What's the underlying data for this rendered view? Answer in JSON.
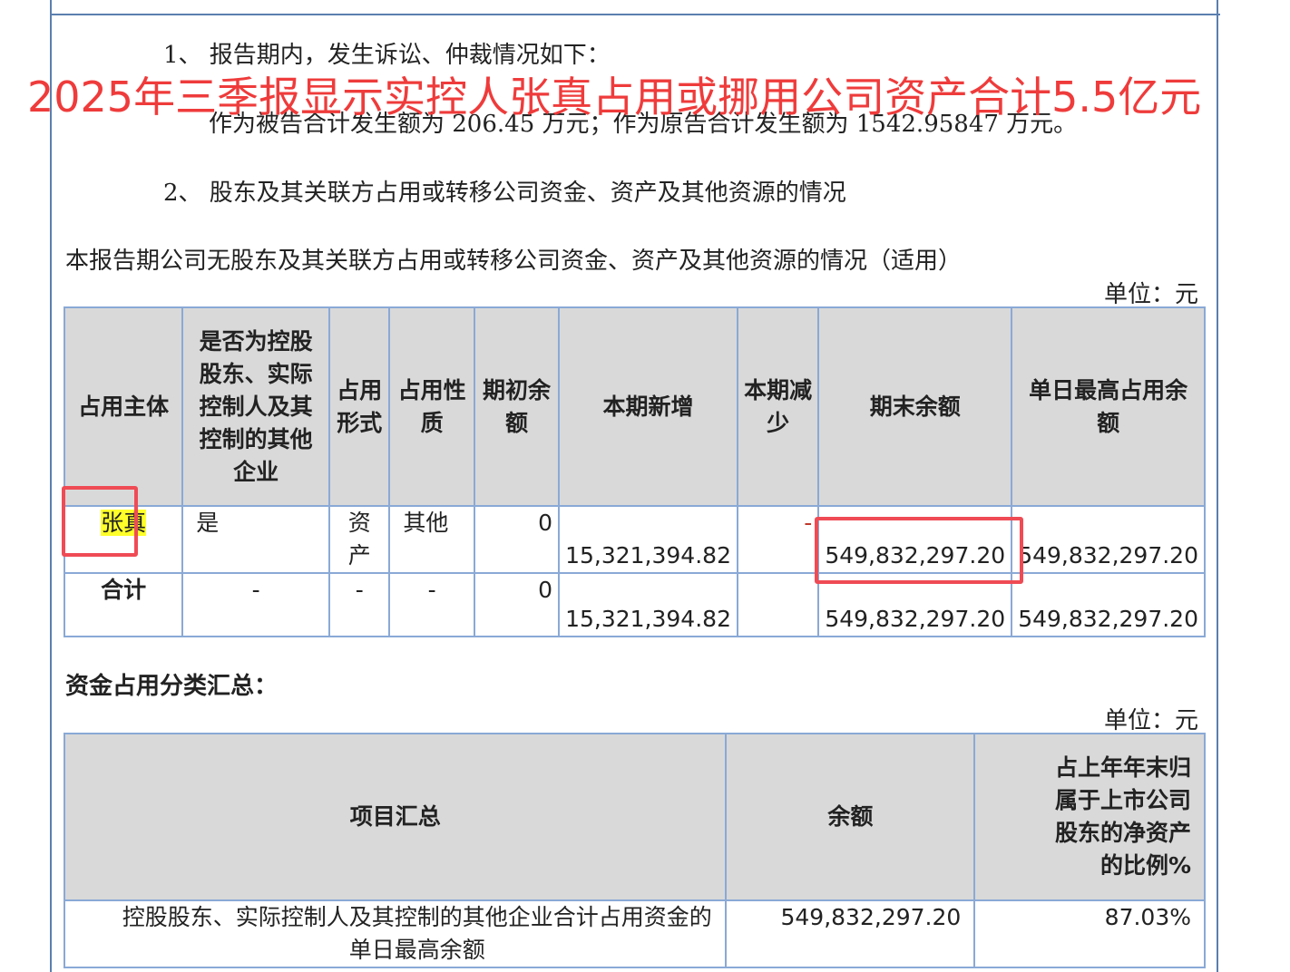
{
  "paragraphs": {
    "p1": "1、 报告期内，发生诉讼、仲裁情况如下：",
    "p2": "作为被告合计发生额为 206.45 万元；作为原告合计发生额为 1542.95847 万元。",
    "p3": "2、 股东及其关联方占用或转移公司资金、资产及其他资源的情况",
    "p4": "本报告期公司无股东及其关联方占用或转移公司资金、资产及其他资源的情况（适用）"
  },
  "overlay_title": "2025年三季报显示实控人张真占用或挪用公司资产合计5.5亿元",
  "unit_label": "单位：元",
  "table1": {
    "headers": [
      "占用主体",
      "是否为控股股东、实际控制人及其控制的其他企业",
      "占用形式",
      "占用性质",
      "期初余额",
      "本期新增",
      "本期减少",
      "期末余额",
      "单日最高占用余额"
    ],
    "rows": [
      {
        "subject": "张真",
        "is_controller": "是",
        "form": "资产",
        "nature": "其他",
        "opening": "0",
        "added": "15,321,394.82",
        "reduced": "-",
        "closing": "549,832,297.20",
        "max_daily": "549,832,297.20"
      },
      {
        "subject": "合计",
        "is_controller": "-",
        "form": "-",
        "nature": "-",
        "opening": "0",
        "added": "15,321,394.82",
        "reduced": "",
        "closing": "549,832,297.20",
        "max_daily": "549,832,297.20"
      }
    ]
  },
  "section_title": "资金占用分类汇总：",
  "table2": {
    "headers": [
      "项目汇总",
      "余额",
      "占上年年末归属于上市公司股东的净资产的比例%"
    ],
    "rows": [
      {
        "item": "控股股东、实际控制人及其控制的其他企业合计占用资金的单日最高余额",
        "balance": "549,832,297.20",
        "ratio": "87.03%"
      }
    ]
  },
  "colors": {
    "overlay_text": "#ef3b3b",
    "highlight_box": "#ef4b55",
    "highlight_fill": "#ffff2a",
    "table_border": "#8aa9d6",
    "header_fill": "#d9d9d9"
  }
}
